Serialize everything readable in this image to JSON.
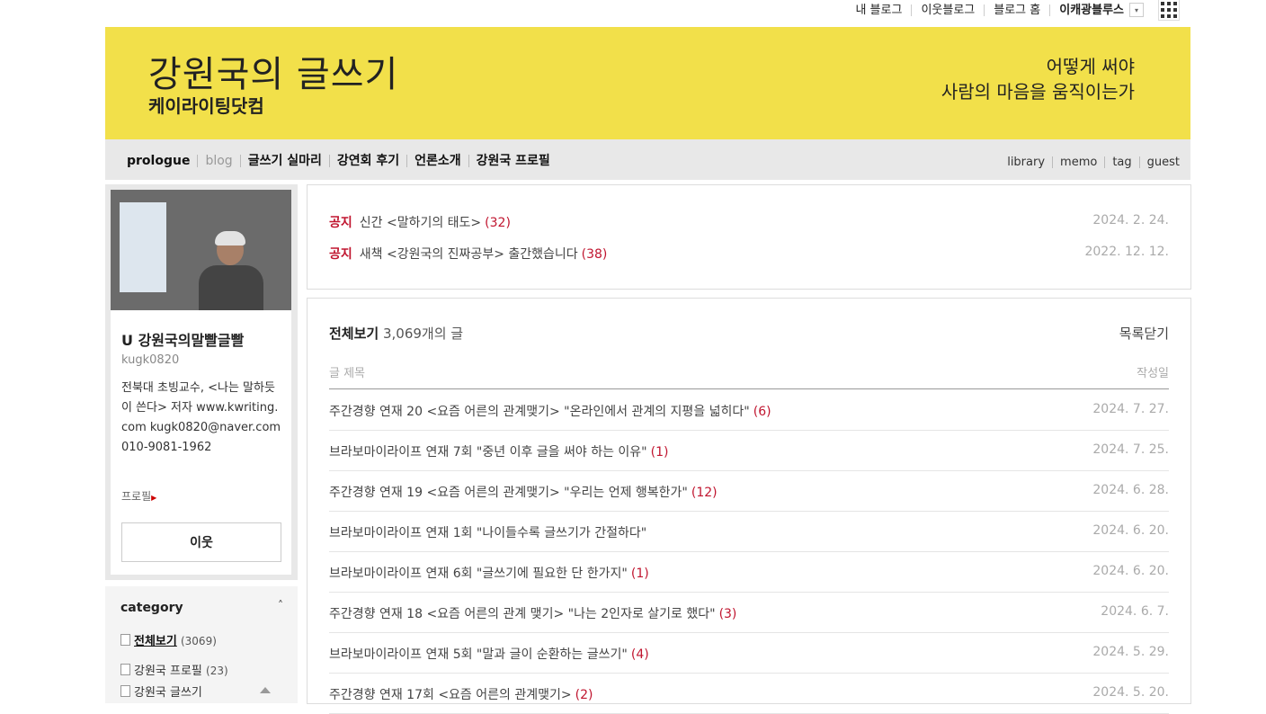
{
  "gnb": {
    "my_blog": "내 블로그",
    "neighbor_blog": "이웃블로그",
    "blog_home": "블로그 홈",
    "user": "이캐광블루스",
    "dropdown_icon": "▾",
    "apps_icon": "grid-icon"
  },
  "banner": {
    "title": "강원국의 글쓰기",
    "subtitle": "케이라이팅닷컴",
    "slogan_line1": "어떻게 써야",
    "slogan_line2": "사람의 마음을 움직이는가"
  },
  "menu": {
    "left": [
      "prologue",
      "blog",
      "글쓰기 실마리",
      "강연회 후기",
      "언론소개",
      "강원국 프로필"
    ],
    "right": [
      "library",
      "memo",
      "tag",
      "guest"
    ]
  },
  "profile": {
    "nickname": "U 강원국의말빨글빨",
    "user_id": "kugk0820",
    "bio": "전북대 초빙교수, <나는 말하듯이 쓴다> 저자 www.kwriting.com kugk0820@naver.com 010-9081-1962",
    "profile_link": "프로필",
    "profile_arrow": "▶",
    "neighbor_button": "이웃"
  },
  "category": {
    "title": "category",
    "toggle": "˄",
    "items": [
      {
        "name": "전체보기",
        "count": "(3069)"
      },
      {
        "name": "강원국 프로필",
        "count": "(23)"
      },
      {
        "name": "강원국 글쓰기",
        "count": ""
      }
    ]
  },
  "notices": [
    {
      "tag": "공지",
      "title": "신간 <말하기의 태도>",
      "comments": "(32)",
      "date": "2024. 2. 24."
    },
    {
      "tag": "공지",
      "title": "새책 <강원국의 진짜공부> 출간했습니다",
      "comments": "(38)",
      "date": "2022. 12. 12."
    }
  ],
  "list": {
    "heading": "전체보기",
    "count_text": "3,069개의 글",
    "close_label": "목록닫기",
    "col_title": "글 제목",
    "col_date": "작성일",
    "posts": [
      {
        "title": "주간경향 연재 20 <요즘 어른의 관계맺기> \"온라인에서 관계의 지평을 넓히다\"",
        "comments": "(6)",
        "date": "2024. 7. 27."
      },
      {
        "title": "브라보마이라이프 연재 7회 \"중년 이후 글을 써야 하는 이유\"",
        "comments": "(1)",
        "date": "2024. 7. 25."
      },
      {
        "title": "주간경향 연재 19 <요즘 어른의 관계맺기> \"우리는 언제 행복한가\"",
        "comments": "(12)",
        "date": "2024. 6. 28."
      },
      {
        "title": "브라보마이라이프 연재 1회 \"나이들수록 글쓰기가 간절하다\"",
        "comments": "",
        "date": "2024. 6. 20."
      },
      {
        "title": "브라보마이라이프 연재 6회 \"글쓰기에 필요한 단 한가지\"",
        "comments": "(1)",
        "date": "2024. 6. 20."
      },
      {
        "title": "주간경향 연재 18 <요즘 어른의 관계 맺기> \"나는 2인자로 살기로 했다\"",
        "comments": "(3)",
        "date": "2024. 6. 7."
      },
      {
        "title": "브라보마이라이프 연재 5회 \"말과 글이 순환하는 글쓰기\"",
        "comments": "(4)",
        "date": "2024. 5. 29."
      },
      {
        "title": "주간경향 연재 17회 <요즘 어른의 관계맺기>",
        "comments": "(2)",
        "date": "2024. 5. 20."
      }
    ]
  },
  "colors": {
    "banner_bg": "#f2e04a",
    "accent_red": "#c0152f",
    "menubar_bg": "#e8e8e8"
  }
}
